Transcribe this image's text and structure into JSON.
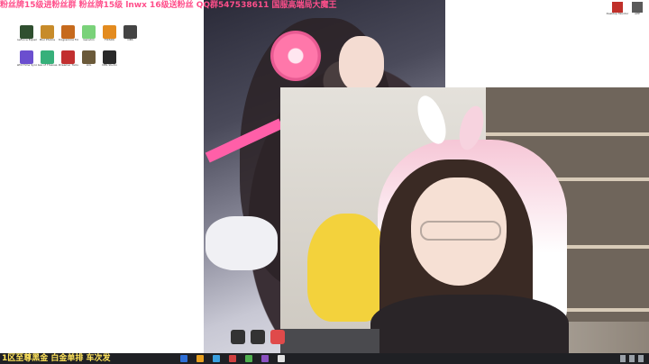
{
  "marquee": {
    "line1": "粉丝牌15级进粉丝群 粉丝牌15级 lnwx 16级送粉丝 QQ群547538611 国服高端局大魔王",
    "line2": ""
  },
  "desktop_left_icons": [
    {
      "label": "GeForce Experience",
      "icon": "nvidia-icon",
      "color": "#2f4f2f"
    },
    {
      "label": "Blur Photos",
      "icon": "app-icon",
      "color": "#c78b2a"
    },
    {
      "label": "Programme Folder",
      "icon": "folder-icon",
      "color": "#c66a1d"
    },
    {
      "label": "Genshin",
      "icon": "game-icon",
      "color": "#7ad27a"
    },
    {
      "label": "FIXSDK",
      "icon": "tool-icon",
      "color": "#e38b1f"
    },
    {
      "label": "OBS",
      "icon": "obs-icon",
      "color": "#444"
    },
    {
      "label": "Wild Time Sync",
      "icon": "sync-icon",
      "color": "#6b4fcf"
    },
    {
      "label": "Sea of Thieves",
      "icon": "ship-icon",
      "color": "#37b07a"
    },
    {
      "label": "Streamer Tools",
      "icon": "stream-icon",
      "color": "#c23030"
    },
    {
      "label": "LOL",
      "icon": "lol-icon",
      "color": "#6b5a3a"
    },
    {
      "label": "OBS Studio",
      "icon": "camera-icon",
      "color": "#2a2a2a"
    }
  ],
  "desktop_right_icons": [
    {
      "label": "Desktop Monitor",
      "icon": "monitor-icon",
      "color": "#c0302a"
    },
    {
      "label": "APP",
      "icon": "app-icon",
      "color": "#5a5a5a"
    }
  ],
  "taskbar": {
    "ticker": "1区至尊黑金 白金单排 车次发",
    "app_colors": [
      "#2f6fd6",
      "#e8a020",
      "#3aa0e0",
      "#d04040",
      "#50b050",
      "#8a50c0",
      "#e0e0e0"
    ]
  },
  "colors": {
    "marquee": "#ff4f8b",
    "ticker": "#ffe45c",
    "taskbar": "#1f2024"
  }
}
